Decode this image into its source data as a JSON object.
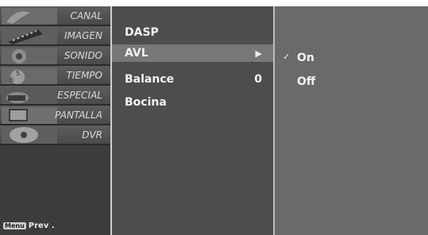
{
  "tabs": [
    {
      "label": "CANAL",
      "icon": "satellite-dish-icon"
    },
    {
      "label": "IMAGEN",
      "icon": "film-strip-icon"
    },
    {
      "label": "SONIDO",
      "icon": "speaker-icon"
    },
    {
      "label": "TIEMPO",
      "icon": "clock-icon"
    },
    {
      "label": "ESPECIAL",
      "icon": "special-icon"
    },
    {
      "label": "PANTALLA",
      "icon": "screen-icon"
    },
    {
      "label": "DVR",
      "icon": "disc-icon"
    }
  ],
  "footer": {
    "menu_badge": "Menu",
    "prev_label": "Prev ."
  },
  "menu": {
    "items": [
      {
        "label": "DASP",
        "value": ""
      },
      {
        "label": "AVL",
        "value": "",
        "arrow": "▶"
      },
      {
        "label": "Balance",
        "value": "0"
      },
      {
        "label": "Bocina",
        "value": ""
      }
    ]
  },
  "submenu": {
    "options": [
      {
        "label": "On",
        "check": "✓"
      },
      {
        "label": "Off",
        "check": ""
      }
    ]
  }
}
